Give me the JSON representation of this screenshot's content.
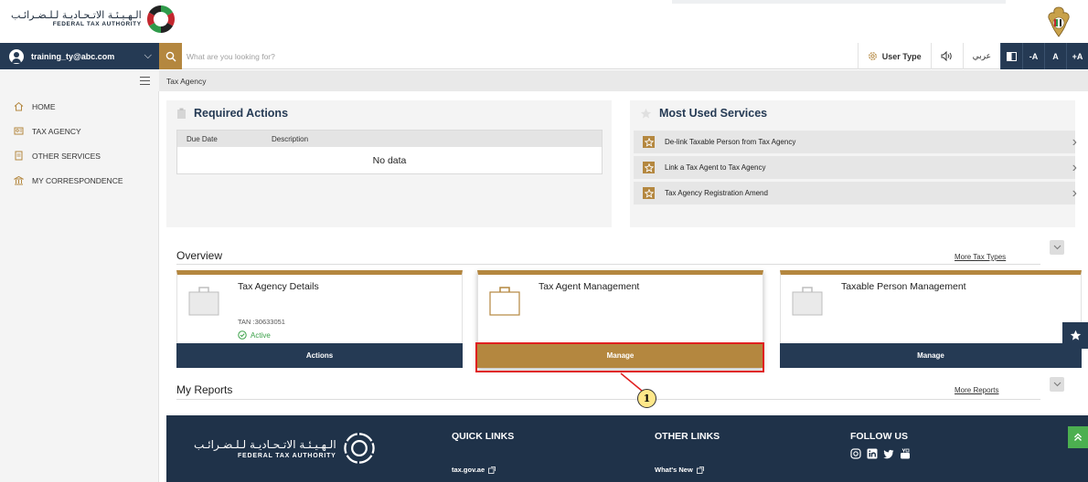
{
  "brand": {
    "name_ar": "الـهـيـئـة الاتـحـاديـة لـلـضـرائـب",
    "name_en": "FEDERAL TAX AUTHORITY"
  },
  "user": {
    "email": "training_ty@abc.com"
  },
  "search": {
    "placeholder": "What are you looking for?"
  },
  "toolbar": {
    "user_type": "User Type",
    "language": "عربي",
    "font_decrease": "-A",
    "font_normal": "A",
    "font_increase": "+A"
  },
  "breadcrumb": {
    "current": "Tax Agency"
  },
  "sidebar": {
    "items": [
      {
        "label": "HOME",
        "icon": "home-icon"
      },
      {
        "label": "TAX AGENCY",
        "icon": "tax-agency-icon"
      },
      {
        "label": "OTHER SERVICES",
        "icon": "services-icon"
      },
      {
        "label": "MY CORRESPONDENCE",
        "icon": "correspondence-icon"
      }
    ]
  },
  "required_actions": {
    "title": "Required Actions",
    "columns": [
      "Due Date",
      "Description"
    ],
    "empty_text": "No data"
  },
  "most_used": {
    "title": "Most Used Services",
    "items": [
      "De-link Taxable Person from Tax Agency",
      "Link a Tax Agent to Tax Agency",
      "Tax Agency Registration Amend"
    ]
  },
  "overview": {
    "title": "Overview",
    "more_link": "More Tax Types",
    "cards": [
      {
        "title": "Tax Agency Details",
        "tan": "TAN :30633051",
        "status": "Active",
        "button": "Actions"
      },
      {
        "title": "Tax Agent Management",
        "button": "Manage"
      },
      {
        "title": "Taxable Person Management",
        "button": "Manage"
      }
    ]
  },
  "reports": {
    "title": "My Reports",
    "more_link": "More Reports"
  },
  "footer": {
    "quick_links_title": "QUICK LINKS",
    "quick_link_1": "tax.gov.ae",
    "other_links_title": "OTHER LINKS",
    "other_link_1": "What's New",
    "follow_us_title": "FOLLOW US"
  },
  "annotation": {
    "step": "1"
  },
  "colors": {
    "navy": "#253a54",
    "gold": "#b4873f",
    "footer": "#1f3249",
    "active": "#3aa148",
    "annotation": "#e02020"
  }
}
